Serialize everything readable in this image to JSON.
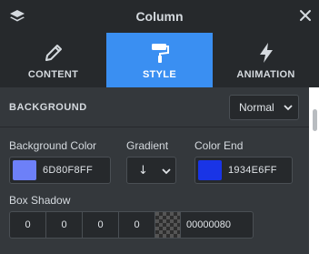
{
  "header": {
    "title": "Column",
    "logo_icon": "layers-icon",
    "close_icon": "close-icon"
  },
  "tabs": [
    {
      "label": "CONTENT",
      "icon": "pencil-icon",
      "active": false
    },
    {
      "label": "STYLE",
      "icon": "paint-roller-icon",
      "active": true
    },
    {
      "label": "ANIMATION",
      "icon": "bolt-icon",
      "active": false
    }
  ],
  "background": {
    "section_title": "BACKGROUND",
    "mode_value": "Normal",
    "background_color": {
      "label": "Background Color",
      "value": "6D80F8FF",
      "swatch": "#6d80f8"
    },
    "gradient": {
      "label": "Gradient",
      "value": "↓"
    },
    "color_end": {
      "label": "Color End",
      "value": "1934E6FF",
      "swatch": "#1934e6"
    },
    "box_shadow": {
      "label": "Box Shadow",
      "values": [
        "0",
        "0",
        "0",
        "0"
      ],
      "color_value": "00000080"
    }
  },
  "colors": {
    "accent": "#3a8ff2",
    "panel": "#34383c",
    "header": "#26292c"
  }
}
